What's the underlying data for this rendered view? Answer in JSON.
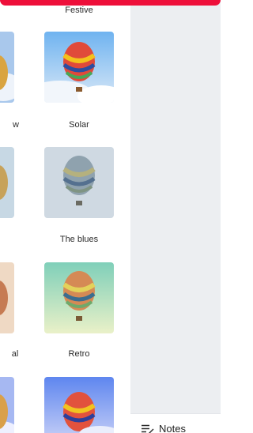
{
  "filters": {
    "items": [
      {
        "label": "Festive"
      },
      {
        "label": "w"
      },
      {
        "label": "Solar"
      },
      {
        "label": "The blues"
      },
      {
        "label": "al"
      },
      {
        "label": "Retro"
      }
    ]
  },
  "footer": {
    "notes_label": "Notes"
  },
  "colors": {
    "top_banner": "#ee0f3a",
    "canvas_bg": "#eceef1"
  }
}
